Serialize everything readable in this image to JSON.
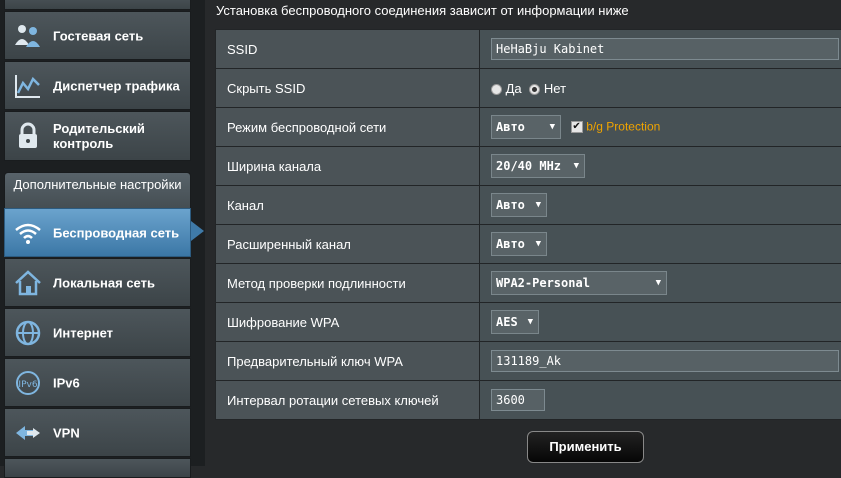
{
  "sidebar": {
    "items": [
      {
        "label": "Гостевая сеть"
      },
      {
        "label": "Диспетчер трафика"
      },
      {
        "label": "Родительский контроль"
      },
      {
        "label": "Беспроводная сеть"
      },
      {
        "label": "Локальная сеть"
      },
      {
        "label": "Интернет"
      },
      {
        "label": "IPv6"
      },
      {
        "label": "VPN"
      }
    ],
    "section_header": "Дополнительные настройки",
    "active_item": "Беспроводная сеть"
  },
  "main": {
    "intro": "Установка беспроводного соединения зависит от информации ниже",
    "rows": {
      "ssid": {
        "label": "SSID",
        "value": "HeHaBju Kabinet"
      },
      "hide_ssid": {
        "label": "Скрыть SSID",
        "option_yes": "Да",
        "option_no": "Нет",
        "selected": "Нет"
      },
      "mode": {
        "label": "Режим беспроводной сети",
        "value": "Авто",
        "checkbox_label": "b/g Protection",
        "checkbox_checked": true
      },
      "bandwidth": {
        "label": "Ширина канала",
        "value": "20/40 MHz"
      },
      "channel": {
        "label": "Канал",
        "value": "Авто"
      },
      "ext_channel": {
        "label": "Расширенный канал",
        "value": "Авто"
      },
      "auth": {
        "label": "Метод проверки подлинности",
        "value": "WPA2-Personal"
      },
      "encryption": {
        "label": "Шифрование WPA",
        "value": "AES"
      },
      "psk": {
        "label": "Предварительный ключ WPA",
        "value": "131189_Ak"
      },
      "rotation": {
        "label": "Интервал ротации сетевых ключей",
        "value": "3600"
      }
    },
    "apply_label": "Применить"
  },
  "colors": {
    "accent_orange": "#f0a400",
    "active_blue": "#3b77a6"
  }
}
